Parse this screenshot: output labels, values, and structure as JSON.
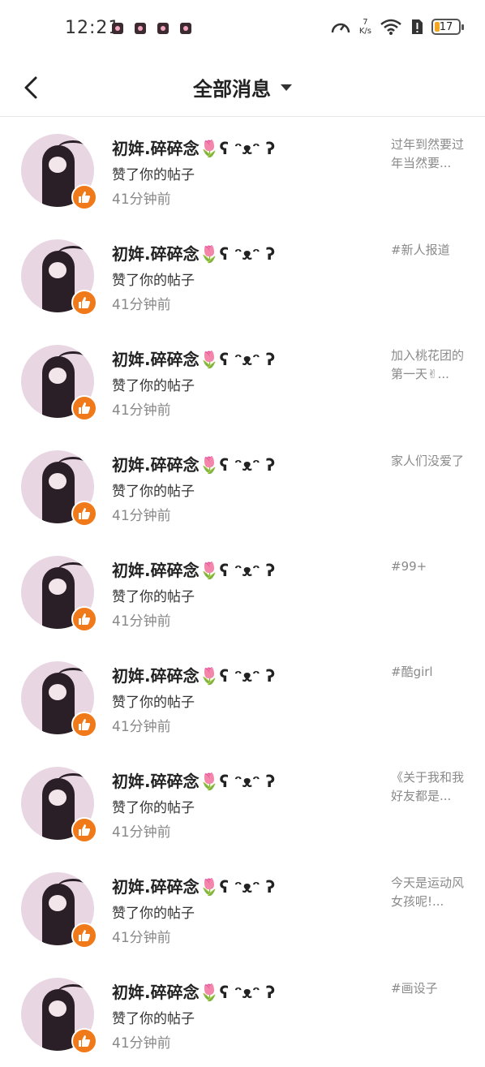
{
  "status_bar": {
    "time": "12:21",
    "net_speed_value": "7",
    "net_speed_unit": "K/s",
    "battery_level": "17",
    "colors": {
      "battery_fill": "#f5a623"
    }
  },
  "header": {
    "title": "全部消息"
  },
  "colors": {
    "like_badge": "#f07a1a",
    "avatar_bg": "#e8d6e2"
  },
  "notifications": [
    {
      "username": "初姩.碎碎念🌷ʕ ᵔᴥᵔ ʔ",
      "action": "赞了你的帖子",
      "time": "41分钟前",
      "preview": "过年到然要过年当然要..."
    },
    {
      "username": "初姩.碎碎念🌷ʕ ᵔᴥᵔ ʔ",
      "action": "赞了你的帖子",
      "time": "41分钟前",
      "preview": "#新人报道"
    },
    {
      "username": "初姩.碎碎念🌷ʕ ᵔᴥᵔ ʔ",
      "action": "赞了你的帖子",
      "time": "41分钟前",
      "preview": "加入桃花团的第一天✌..."
    },
    {
      "username": "初姩.碎碎念🌷ʕ ᵔᴥᵔ ʔ",
      "action": "赞了你的帖子",
      "time": "41分钟前",
      "preview": "家人们没爱了"
    },
    {
      "username": "初姩.碎碎念🌷ʕ ᵔᴥᵔ ʔ",
      "action": "赞了你的帖子",
      "time": "41分钟前",
      "preview": "#99+"
    },
    {
      "username": "初姩.碎碎念🌷ʕ ᵔᴥᵔ ʔ",
      "action": "赞了你的帖子",
      "time": "41分钟前",
      "preview": "#酷girl"
    },
    {
      "username": "初姩.碎碎念🌷ʕ ᵔᴥᵔ ʔ",
      "action": "赞了你的帖子",
      "time": "41分钟前",
      "preview": "《关于我和我好友都是..."
    },
    {
      "username": "初姩.碎碎念🌷ʕ ᵔᴥᵔ ʔ",
      "action": "赞了你的帖子",
      "time": "41分钟前",
      "preview": "今天是运动风女孩呢!..."
    },
    {
      "username": "初姩.碎碎念🌷ʕ ᵔᴥᵔ ʔ",
      "action": "赞了你的帖子",
      "time": "41分钟前",
      "preview": "#画设子"
    }
  ]
}
